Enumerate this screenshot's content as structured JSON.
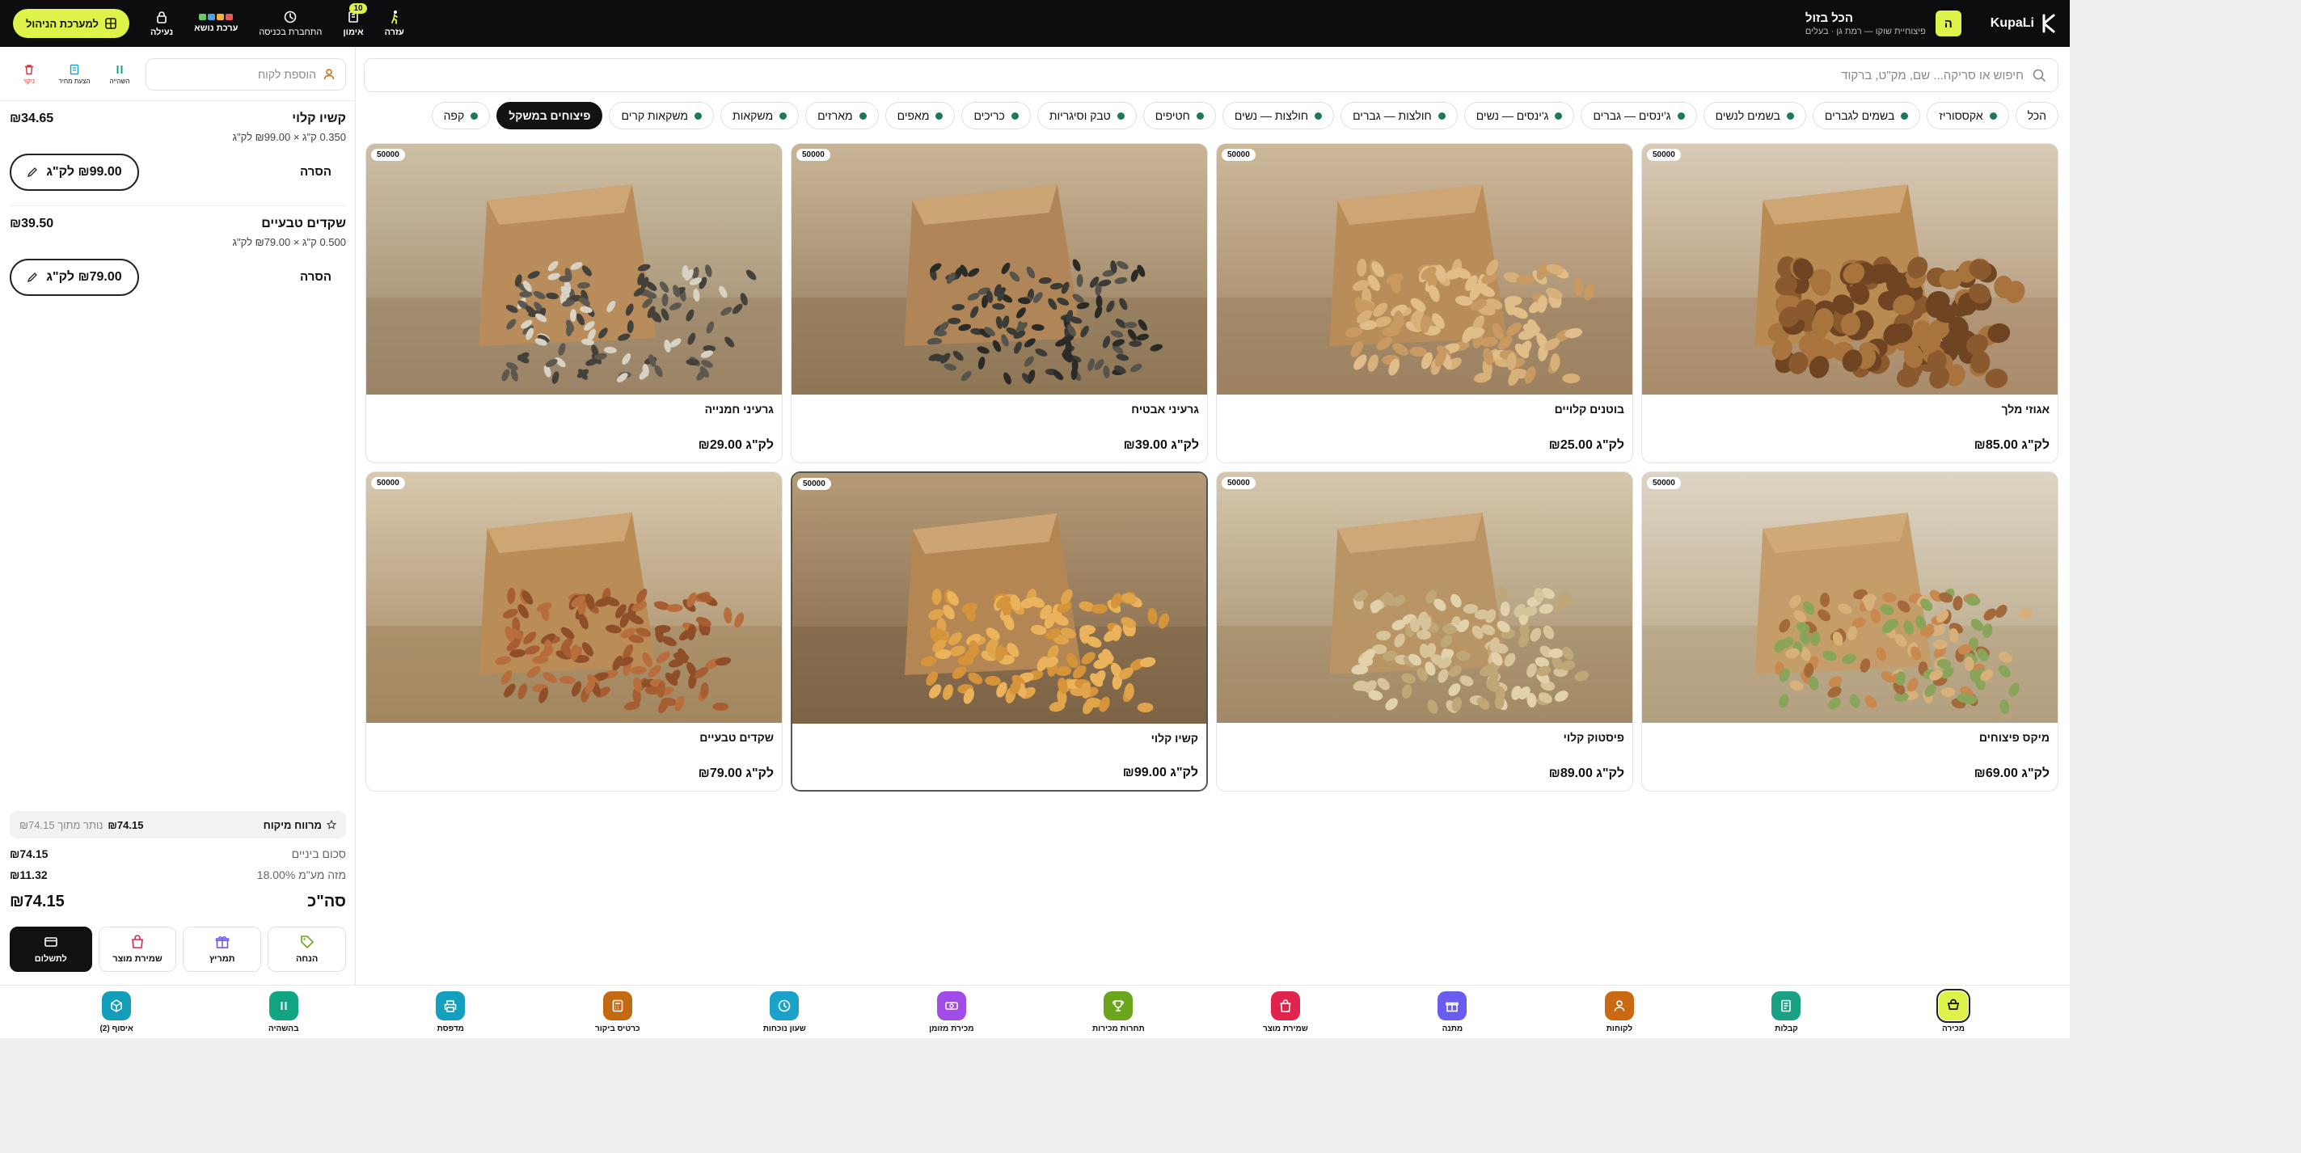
{
  "header": {
    "logo_text": "KupaLi",
    "store_initial": "ה",
    "store_name": "הכל בזול",
    "store_sub": "פיצוחיית שוקו — רמת גן · בעלים",
    "actions": [
      {
        "id": "help",
        "label": "עזרה",
        "icon": "person-walking-icon"
      },
      {
        "id": "training",
        "label": "אימון",
        "icon": "book-icon",
        "badge": "10"
      },
      {
        "id": "shift",
        "label": "התחברת בכניסה",
        "icon": "clock-icon"
      },
      {
        "id": "theme",
        "label": "ערכת נושא",
        "icon": "palette-icon"
      },
      {
        "id": "lock",
        "label": "נעילה",
        "icon": "lock-icon"
      }
    ],
    "mgmt_button": "למערכת הניהול"
  },
  "search": {
    "placeholder": "חיפוש או סריקה... שם, מק\"ט, ברקוד"
  },
  "categories": [
    {
      "label": "הכל",
      "dot": false,
      "active": false
    },
    {
      "label": "אקססוריז",
      "dot": true,
      "active": false
    },
    {
      "label": "בשמים לגברים",
      "dot": true,
      "active": false
    },
    {
      "label": "בשמים לנשים",
      "dot": true,
      "active": false
    },
    {
      "label": "ג'ינסים — גברים",
      "dot": true,
      "active": false
    },
    {
      "label": "ג'ינסים — נשים",
      "dot": true,
      "active": false
    },
    {
      "label": "חולצות — גברים",
      "dot": true,
      "active": false
    },
    {
      "label": "חולצות — נשים",
      "dot": true,
      "active": false
    },
    {
      "label": "חטיפים",
      "dot": true,
      "active": false
    },
    {
      "label": "טבק וסיגריות",
      "dot": true,
      "active": false
    },
    {
      "label": "כריכים",
      "dot": true,
      "active": false
    },
    {
      "label": "מאפים",
      "dot": true,
      "active": false
    },
    {
      "label": "מארזים",
      "dot": true,
      "active": false
    },
    {
      "label": "משקאות",
      "dot": true,
      "active": false
    },
    {
      "label": "משקאות קרים",
      "dot": true,
      "active": false
    },
    {
      "label": "פיצוחים במשקל",
      "dot": false,
      "active": true
    },
    {
      "label": "קפה",
      "dot": true,
      "active": false
    }
  ],
  "products": [
    {
      "sku": "50000",
      "name": "אגוזי מלך",
      "price": "₪85.00 לק\"ג",
      "nut": "walnut",
      "selected": false
    },
    {
      "sku": "50000",
      "name": "בוטנים קלויים",
      "price": "₪25.00 לק\"ג",
      "nut": "peanut",
      "selected": false
    },
    {
      "sku": "50000",
      "name": "גרעיני אבטיח",
      "price": "₪39.00 לק\"ג",
      "nut": "seed-dark",
      "selected": false
    },
    {
      "sku": "50000",
      "name": "גרעיני חמנייה",
      "price": "₪29.00 לק\"ג",
      "nut": "seed-striped",
      "selected": false
    },
    {
      "sku": "50000",
      "name": "מיקס פיצוחים",
      "price": "₪69.00 לק\"ג",
      "nut": "mix",
      "selected": false
    },
    {
      "sku": "50000",
      "name": "פיסטוק קלוי",
      "price": "₪89.00 לק\"ג",
      "nut": "pistachio",
      "selected": false
    },
    {
      "sku": "50000",
      "name": "קשיו קלוי",
      "price": "₪99.00 לק\"ג",
      "nut": "cashew",
      "selected": true
    },
    {
      "sku": "50000",
      "name": "שקדים טבעיים",
      "price": "₪79.00 לק\"ג",
      "nut": "almond",
      "selected": false
    }
  ],
  "cart": {
    "customer_placeholder": "הוספת לקוח",
    "tools": [
      {
        "label": "השהייה",
        "icon": "pause-icon"
      },
      {
        "label": "הצעת מחיר",
        "icon": "document-icon"
      },
      {
        "label": "ניקוי",
        "icon": "trash-icon"
      }
    ],
    "lines": [
      {
        "name": "קשיו קלוי",
        "total": "₪34.65",
        "detail": "0.350 ק\"ג × ₪99.00 לק\"ג",
        "unit_price": "₪99.00 לק\"ג",
        "remove": "הסרה"
      },
      {
        "name": "שקדים טבעיים",
        "total": "₪39.50",
        "detail": "0.500 ק\"ג × ₪79.00 לק\"ג",
        "unit_price": "₪79.00 לק\"ג",
        "remove": "הסרה"
      }
    ],
    "profit_label": "מרווח מיקוח",
    "profit_value": "₪74.15",
    "profit_note": "נותר מתוך ₪74.15",
    "subtotal_label": "סכום ביניים",
    "subtotal_value": "₪74.15",
    "vat_label": "מזה מע\"מ 18.00%",
    "vat_value": "₪11.32",
    "total_label": "סה\"כ",
    "total_value": "₪74.15",
    "buttons": [
      {
        "label": "הנחה",
        "icon": "tag-icon"
      },
      {
        "label": "תמריץ",
        "icon": "gift-icon"
      },
      {
        "label": "שמירת מוצר",
        "icon": "bag-icon"
      },
      {
        "label": "לתשלום",
        "icon": "card-icon"
      }
    ]
  },
  "dock": [
    {
      "label": "מכירה",
      "color": "#dff24a",
      "icon": "cart-icon",
      "active": true
    },
    {
      "label": "קבלות",
      "color": "#1aa085",
      "icon": "receipt-icon"
    },
    {
      "label": "לקוחות",
      "color": "#c96a12",
      "icon": "user-icon"
    },
    {
      "label": "מתנה",
      "color": "#6b5cf0",
      "icon": "gift-icon"
    },
    {
      "label": "שמירת מוצר",
      "color": "#e0244e",
      "icon": "bag-icon"
    },
    {
      "label": "תחרות מכירות",
      "color": "#6aa51c",
      "icon": "trophy-icon"
    },
    {
      "label": "מכירת מזומן",
      "color": "#a14be8",
      "icon": "cash-icon"
    },
    {
      "label": "שעון נוכחות",
      "color": "#1ba2c8",
      "icon": "clock-icon"
    },
    {
      "label": "כרטיס ביקור",
      "color": "#c46a12",
      "icon": "calculator-icon"
    },
    {
      "label": "מדפסת",
      "color": "#139fbd",
      "icon": "printer-icon"
    },
    {
      "label": "בהשהיה",
      "color": "#11a584",
      "icon": "pause-icon"
    },
    {
      "label": "איסוף (2)",
      "color": "#129eb8",
      "icon": "package-icon"
    }
  ]
}
